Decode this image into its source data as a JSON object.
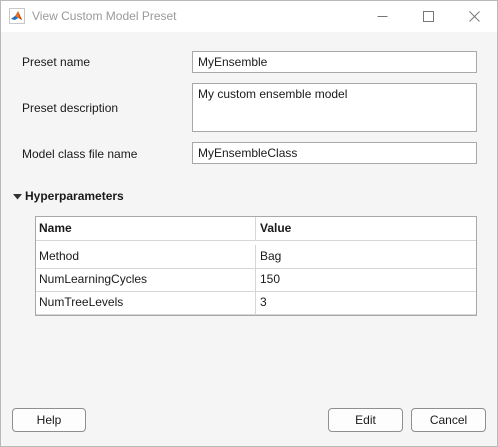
{
  "window": {
    "title": "View Custom Model Preset"
  },
  "form": {
    "preset_name_label": "Preset name",
    "preset_name_value": "MyEnsemble",
    "preset_description_label": "Preset description",
    "preset_description_value": "My custom ensemble model",
    "model_class_label": "Model class file name",
    "model_class_value": "MyEnsembleClass"
  },
  "hyperparameters": {
    "section_title": "Hyperparameters",
    "expanded": true,
    "columns": [
      "Name",
      "Value"
    ],
    "rows": [
      [
        "Method",
        "Bag"
      ],
      [
        "NumLearningCycles",
        "150"
      ],
      [
        "NumTreeLevels",
        "3"
      ]
    ]
  },
  "buttons": {
    "help": "Help",
    "edit": "Edit",
    "cancel": "Cancel"
  },
  "icons": {
    "app": "matlab-logo-icon",
    "minimize": "minimize-icon",
    "maximize": "maximize-icon",
    "close": "close-icon",
    "section_toggle": "triangle-down-icon"
  }
}
